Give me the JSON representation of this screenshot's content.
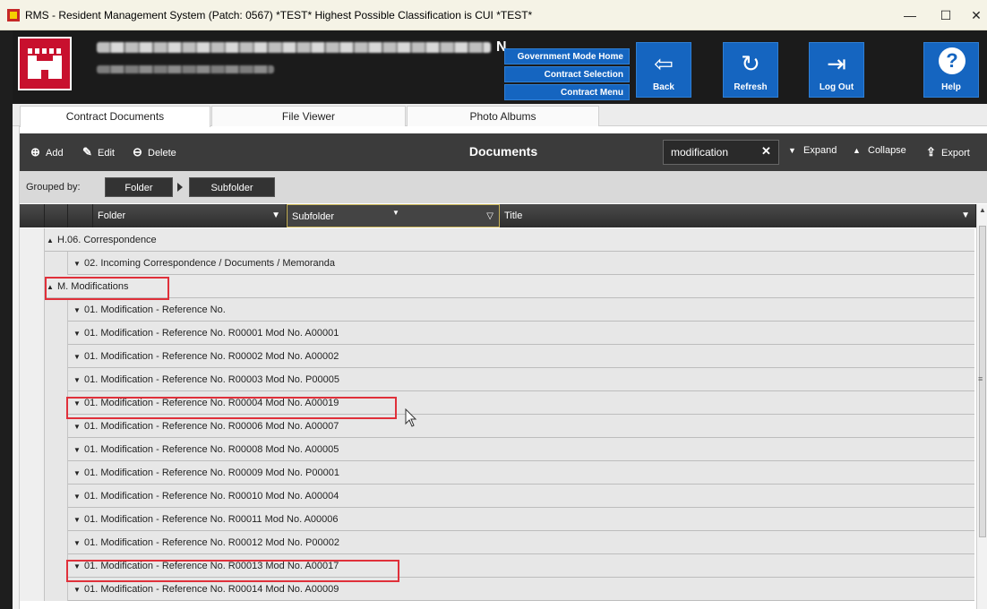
{
  "window": {
    "title": "RMS - Resident Management System (Patch: 0567) *TEST*    Highest Possible Classification is CUI  *TEST*",
    "minimize": "—",
    "maximize": "☐",
    "close": "✕"
  },
  "header": {
    "title_suffix": "N",
    "gov_buttons": [
      "Government Mode Home",
      "Contract Selection",
      "Contract Menu"
    ],
    "buttons": [
      {
        "label": "Back",
        "icon": "⇦"
      },
      {
        "label": "Refresh",
        "icon": "↻"
      },
      {
        "label": "Log Out",
        "icon": "⇥"
      },
      {
        "label": "Help",
        "icon": "?"
      }
    ]
  },
  "tabs": [
    "Contract Documents",
    "File Viewer",
    "Photo Albums"
  ],
  "toolbar": {
    "add": "Add",
    "edit": "Edit",
    "delete": "Delete",
    "title": "Documents",
    "search_value": "modification",
    "clear": "✕",
    "expand": "Expand",
    "collapse": "Collapse",
    "export": "Export"
  },
  "grouping": {
    "label": "Grouped by:",
    "chips": [
      "Folder",
      "Subfolder"
    ]
  },
  "columns": [
    "Folder",
    "Subfolder",
    "Title"
  ],
  "rows": [
    {
      "level": 1,
      "chevron": "^",
      "text": "H.06. Correspondence"
    },
    {
      "level": 2,
      "chevron": "v",
      "text": "02. Incoming Correspondence / Documents / Memoranda"
    },
    {
      "level": 1,
      "chevron": "^",
      "text": "M. Modifications",
      "highlight": true
    },
    {
      "level": 2,
      "chevron": "v",
      "text": "01. Modification - Reference No."
    },
    {
      "level": 2,
      "chevron": "v",
      "text": "01. Modification - Reference No. R00001 Mod No. A00001"
    },
    {
      "level": 2,
      "chevron": "v",
      "text": "01. Modification - Reference No. R00002 Mod No. A00002"
    },
    {
      "level": 2,
      "chevron": "v",
      "text": "01. Modification - Reference No. R00003 Mod No. P00005"
    },
    {
      "level": 2,
      "chevron": "v",
      "text": "01. Modification - Reference No. R00004 Mod No. A00019",
      "highlight": true
    },
    {
      "level": 2,
      "chevron": "v",
      "text": "01. Modification - Reference No. R00006 Mod No. A00007"
    },
    {
      "level": 2,
      "chevron": "v",
      "text": "01. Modification - Reference No. R00008 Mod No. A00005"
    },
    {
      "level": 2,
      "chevron": "v",
      "text": "01. Modification - Reference No. R00009 Mod No. P00001"
    },
    {
      "level": 2,
      "chevron": "v",
      "text": "01. Modification - Reference No. R00010 Mod No. A00004"
    },
    {
      "level": 2,
      "chevron": "v",
      "text": "01. Modification - Reference No. R00011 Mod No. A00006"
    },
    {
      "level": 2,
      "chevron": "v",
      "text": "01. Modification - Reference No. R00012 Mod No. P00002"
    },
    {
      "level": 2,
      "chevron": "v",
      "text": "01. Modification - Reference No. R00013 Mod No. A00017",
      "highlight": true
    },
    {
      "level": 2,
      "chevron": "v",
      "text": "01. Modification - Reference No. R00014 Mod No. A00009"
    }
  ],
  "colors": {
    "accent_blue": "#1565c0",
    "header_dark": "#1b1b1b",
    "highlight_red": "#e0303a",
    "logo_red": "#c8102e"
  }
}
